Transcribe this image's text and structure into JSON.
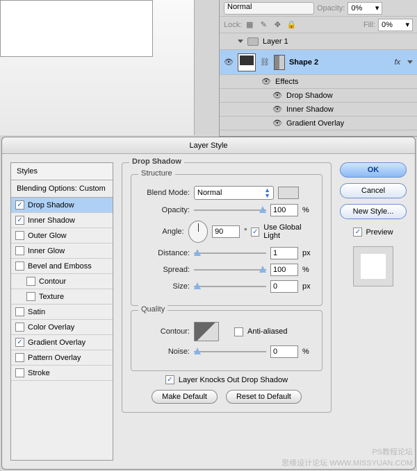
{
  "layers_panel": {
    "blend_mode": "Normal",
    "opacity_label": "Opacity:",
    "opacity_value": "0%",
    "lock_label": "Lock:",
    "fill_label": "Fill:",
    "fill_value": "0%",
    "group_name": "Layer 1",
    "shape_name": "Shape 2",
    "fx_label": "fx",
    "effects_label": "Effects",
    "effects": [
      "Drop Shadow",
      "Inner Shadow",
      "Gradient Overlay"
    ]
  },
  "dialog": {
    "title": "Layer Style",
    "styles_header": "Styles",
    "blending_header": "Blending Options: Custom",
    "items": [
      {
        "label": "Drop Shadow",
        "checked": true,
        "selected": true
      },
      {
        "label": "Inner Shadow",
        "checked": true
      },
      {
        "label": "Outer Glow",
        "checked": false
      },
      {
        "label": "Inner Glow",
        "checked": false
      },
      {
        "label": "Bevel and Emboss",
        "checked": false
      },
      {
        "label": "Contour",
        "checked": false,
        "indent": true
      },
      {
        "label": "Texture",
        "checked": false,
        "indent": true
      },
      {
        "label": "Satin",
        "checked": false
      },
      {
        "label": "Color Overlay",
        "checked": false
      },
      {
        "label": "Gradient Overlay",
        "checked": true
      },
      {
        "label": "Pattern Overlay",
        "checked": false
      },
      {
        "label": "Stroke",
        "checked": false
      }
    ],
    "panel_title": "Drop Shadow",
    "structure_title": "Structure",
    "blend_mode_label": "Blend Mode:",
    "blend_mode_value": "Normal",
    "opacity_label": "Opacity:",
    "opacity_value": "100",
    "angle_label": "Angle:",
    "angle_value": "90",
    "global_light_label": "Use Global Light",
    "distance_label": "Distance:",
    "distance_value": "1",
    "spread_label": "Spread:",
    "spread_value": "100",
    "size_label": "Size:",
    "size_value": "0",
    "px_unit": "px",
    "pct_unit": "%",
    "deg_unit": "°",
    "quality_title": "Quality",
    "contour_label": "Contour:",
    "antialiased_label": "Anti-aliased",
    "noise_label": "Noise:",
    "noise_value": "0",
    "knockout_label": "Layer Knocks Out Drop Shadow",
    "make_default": "Make Default",
    "reset_default": "Reset to Default",
    "ok": "OK",
    "cancel": "Cancel",
    "new_style": "New Style...",
    "preview_label": "Preview"
  },
  "watermark": {
    "line1": "PS教程论坛",
    "line2": "思缘设计论坛  WWW.MISSYUAN.COM"
  }
}
